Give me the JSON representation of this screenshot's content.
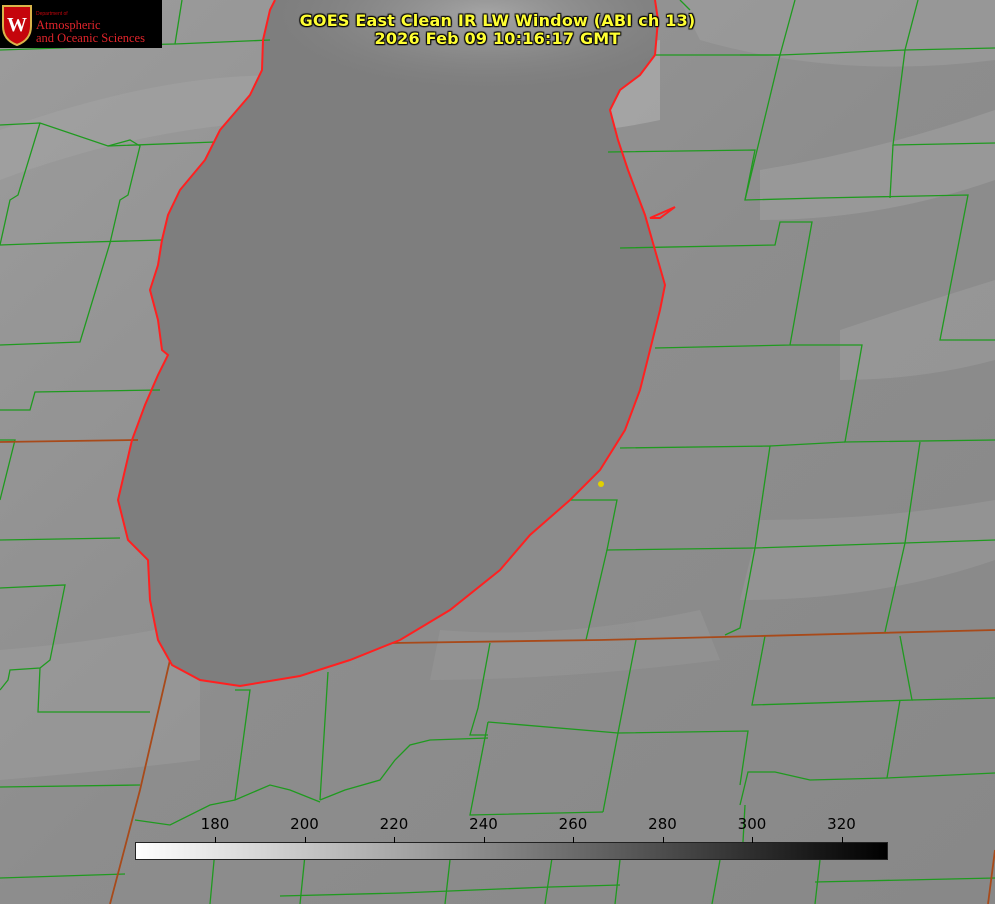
{
  "title": {
    "line1": "GOES East Clean IR LW Window (ABI ch 13)",
    "line2": "2026 Feb 09 10:16:17 GMT"
  },
  "logo": {
    "dept": "Department of",
    "line1": "Atmospheric",
    "line2": "and Oceanic Sciences",
    "icon": "uw-crest-icon",
    "crest_letter": "W"
  },
  "colorbar": {
    "ticks": [
      "180",
      "200",
      "220",
      "240",
      "260",
      "280",
      "300",
      "320"
    ],
    "colormap": "grayscale (white = cold, black = warm)"
  },
  "colors": {
    "lake_shoreline": "#ff2020",
    "county_lines": "#1f9a1f",
    "state_lines": "#a84a1a",
    "title_text": "#ffff33",
    "marker": "#e0d000"
  }
}
